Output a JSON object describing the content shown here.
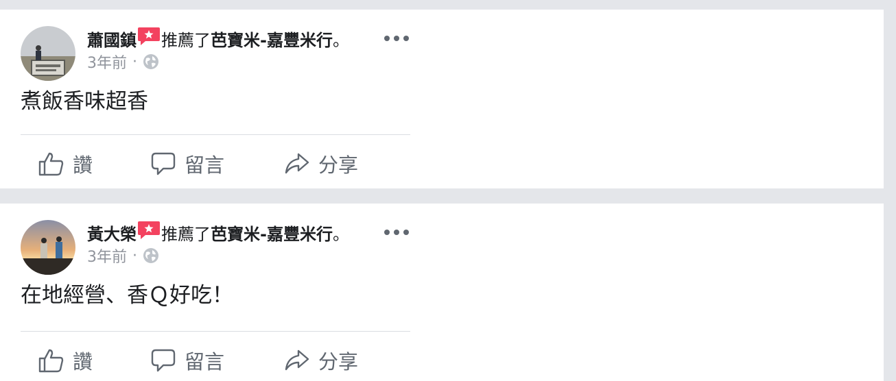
{
  "posts": [
    {
      "author": "蕭國鎮",
      "recommend_text": "推薦了",
      "page_name": "芭寶米-嘉豐米行",
      "period": "。",
      "time": "3年前",
      "separator": "·",
      "privacy_icon": "globe-icon",
      "text": "煮飯香味超香",
      "actions": {
        "like": "讚",
        "comment": "留言",
        "share": "分享"
      }
    },
    {
      "author": "黃大榮",
      "recommend_text": "推薦了",
      "page_name": "芭寶米-嘉豐米行",
      "period": "。",
      "time": "3年前",
      "separator": "·",
      "privacy_icon": "globe-icon",
      "text": "在地經營、香Ｑ好吃！",
      "actions": {
        "like": "讚",
        "comment": "留言",
        "share": "分享"
      }
    }
  ],
  "colors": {
    "background": "#e4e6ea",
    "card": "#ffffff",
    "text": "#1c1e21",
    "meta": "#90949c",
    "action": "#606770",
    "recommend_badge": "#f3425f"
  }
}
